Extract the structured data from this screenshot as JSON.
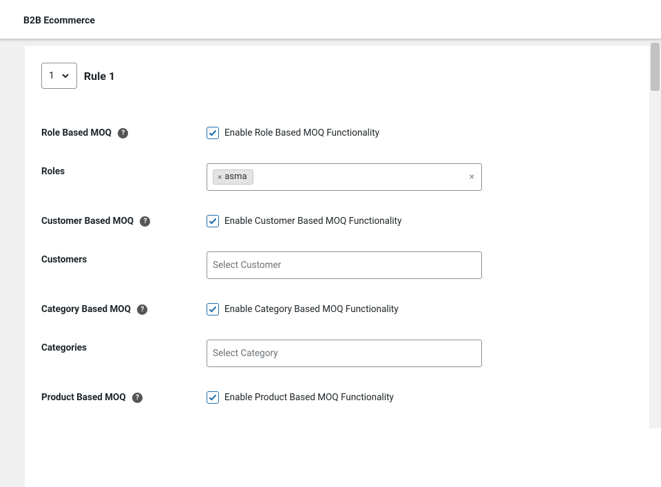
{
  "header": {
    "title": "B2B Ecommerce"
  },
  "rule": {
    "number": "1",
    "title": "Rule 1"
  },
  "rows": {
    "role_moq": {
      "label": "Role Based MOQ",
      "help": "?",
      "cb_label": "Enable Role Based MOQ Functionality"
    },
    "roles": {
      "label": "Roles",
      "tag_text": "asma",
      "tag_remove": "×",
      "clear": "×"
    },
    "customer_moq": {
      "label": "Customer Based MOQ",
      "help": "?",
      "cb_label": "Enable Customer Based MOQ Functionality"
    },
    "customers": {
      "label": "Customers",
      "placeholder": "Select Customer"
    },
    "category_moq": {
      "label": "Category Based MOQ",
      "help": "?",
      "cb_label": "Enable Category Based MOQ Functionality"
    },
    "categories": {
      "label": "Categories",
      "placeholder": "Select Category"
    },
    "product_moq": {
      "label": "Product Based MOQ",
      "help": "?",
      "cb_label": "Enable Product Based MOQ Functionality"
    }
  }
}
